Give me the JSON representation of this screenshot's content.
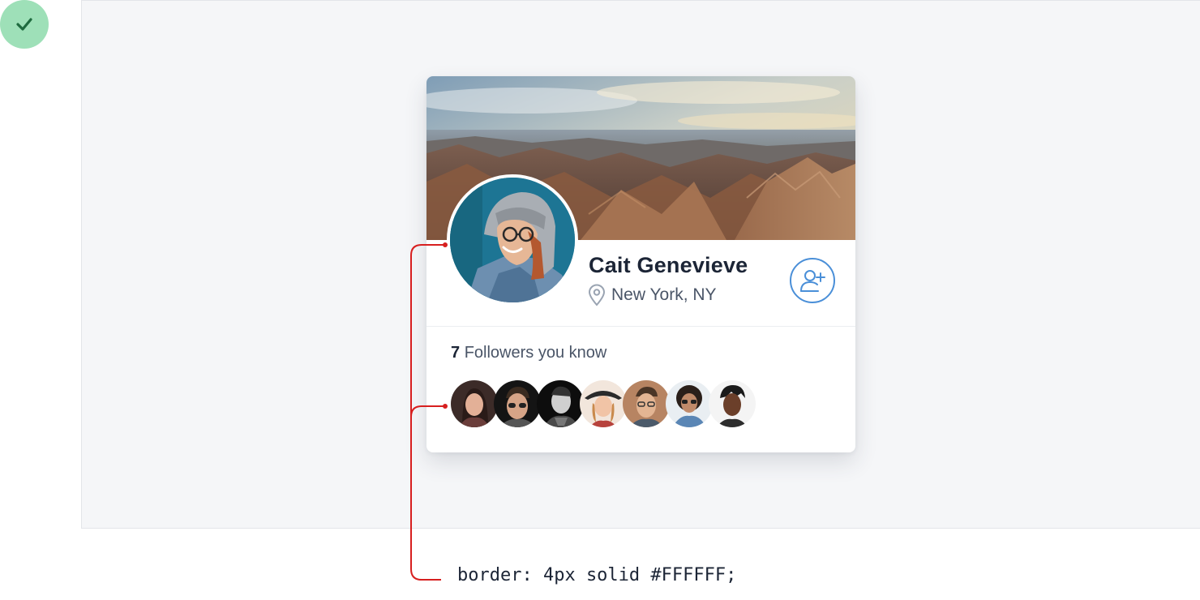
{
  "profile": {
    "name": "Cait Genevieve",
    "location": "New York, NY"
  },
  "followers": {
    "count": "7",
    "label": "Followers you know",
    "avatars": [
      "follower-1",
      "follower-2",
      "follower-3",
      "follower-4",
      "follower-5",
      "follower-6",
      "follower-7"
    ]
  },
  "annotation": {
    "code": "border: 4px solid #FFFFFF;"
  },
  "colors": {
    "accent": "#4a8fd8",
    "annotation": "#d71f1f",
    "success_badge": "#9ee0b8",
    "check": "#1f6b3f"
  },
  "icons": [
    "check-icon",
    "location-pin-icon",
    "add-user-icon"
  ]
}
